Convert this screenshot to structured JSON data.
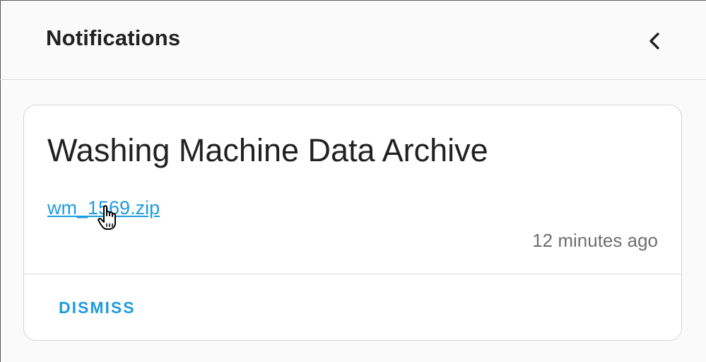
{
  "header": {
    "title": "Notifications",
    "back_icon": "chevron-left-icon"
  },
  "notification": {
    "title": "Washing Machine Data Archive",
    "file_name": "wm_1569.zip",
    "time_ago": "12 minutes ago",
    "dismiss_label": "DISMISS"
  },
  "colors": {
    "accent": "#1e9be0",
    "background": "#fafafa",
    "card": "#ffffff",
    "muted_text": "#6f6f6f"
  },
  "cursor_icon": "hand-pointer-icon"
}
